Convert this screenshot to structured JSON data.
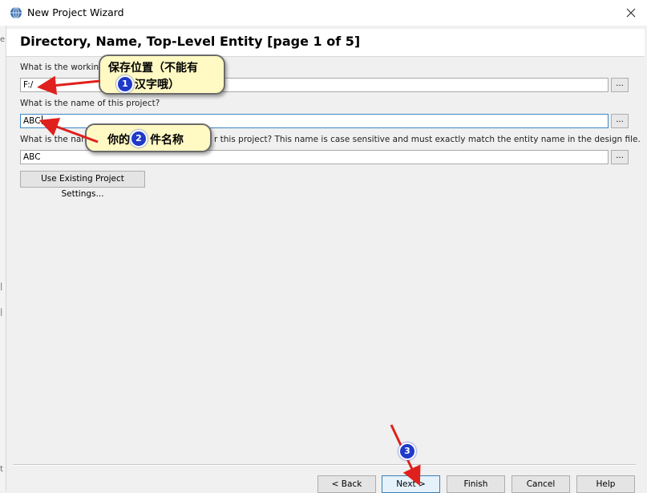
{
  "window": {
    "title": "New Project Wizard"
  },
  "page": {
    "title": "Directory, Name, Top-Level Entity [page 1 of 5]"
  },
  "fields": {
    "directory_label": "What is the working",
    "directory_value": "F:/",
    "name_label": "What is the name of this project?",
    "name_value": "ABC",
    "entity_label_start": "What is the nam",
    "entity_label_end": "r this project? This name is case sensitive and must exactly match the entity name in the design file.",
    "entity_value": "ABC",
    "browse_label": "..."
  },
  "buttons": {
    "use_existing": "Use Existing Project Settings...",
    "back": "< Back",
    "next": "Next >",
    "finish": "Finish",
    "cancel": "Cancel",
    "help": "Help"
  },
  "annotations": {
    "callout1_line1": "保存位置（不能有",
    "callout1_line2": "汉字哦）",
    "callout2_a": "你的",
    "callout2_b": "件名称",
    "badge1": "1",
    "badge2": "2",
    "badge3": "3"
  },
  "colors": {
    "callout_fill": "#fff9c4",
    "arrow": "#e0201c",
    "badge": "#1f39c9",
    "focus_border": "#3d86c6"
  }
}
